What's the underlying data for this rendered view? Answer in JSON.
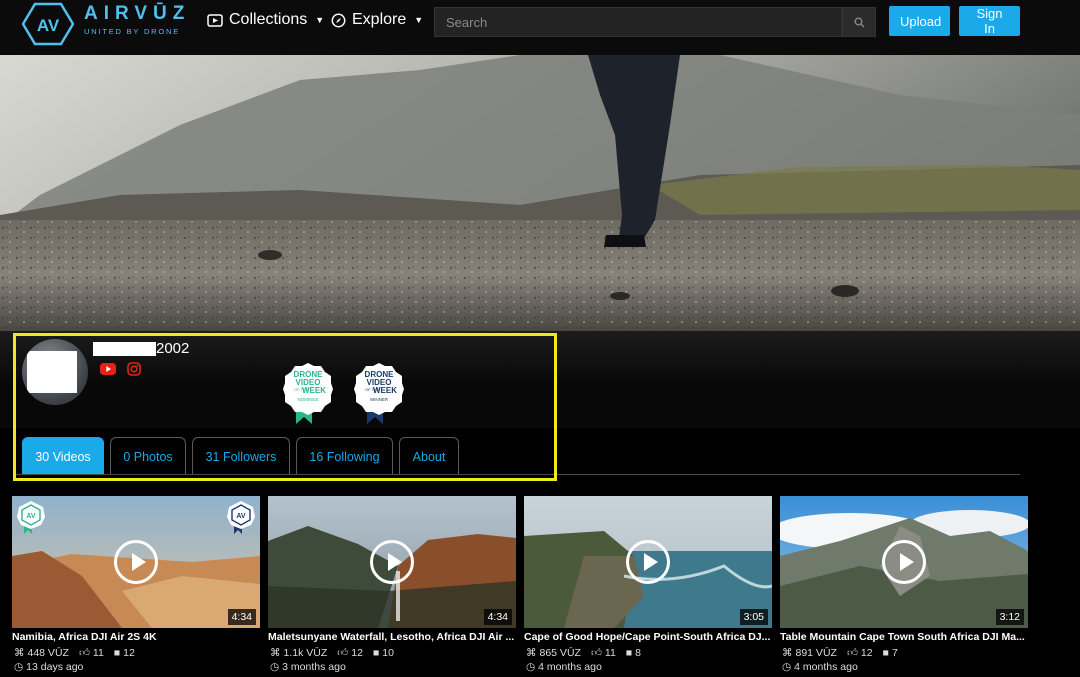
{
  "brand": {
    "name": "AIRVŪZ",
    "tagline": "UNITED BY DRONE",
    "logo_text": "AV"
  },
  "nav": {
    "collections": "Collections",
    "explore": "Explore",
    "search_placeholder": "Search",
    "upload": "Upload",
    "sign_in": "Sign In"
  },
  "profile": {
    "username_suffix": "2002",
    "social": [
      "youtube-icon",
      "instagram-icon"
    ],
    "badges": [
      {
        "line1": "DRONE",
        "line2": "VIDEO",
        "line3": "OF THE",
        "line4": "WEEK",
        "line5": "NOMINEE",
        "color": "#2bb58a"
      },
      {
        "line1": "DRONE",
        "line2": "VIDEO",
        "line3": "OF THE",
        "line4": "WEEK",
        "line5": "WINNER",
        "color": "#1b3a6b"
      }
    ]
  },
  "tabs": [
    {
      "label": "30 Videos",
      "active": true
    },
    {
      "label": "0 Photos"
    },
    {
      "label": "31 Followers"
    },
    {
      "label": "16 Following"
    },
    {
      "label": "About"
    }
  ],
  "videos": [
    {
      "title": "Namibia, Africa DJI Air 2S 4K",
      "views": "448 VŪZ",
      "likes": "11",
      "comments": "12",
      "age": "13 days ago",
      "duration": "4:34"
    },
    {
      "title": "Maletsunyane Waterfall, Lesotho, Africa DJI Air ...",
      "views": "1.1k VŪZ",
      "likes": "12",
      "comments": "10",
      "age": "3 months ago",
      "duration": "4:34"
    },
    {
      "title": "Cape of Good Hope/Cape Point-South Africa DJ...",
      "views": "865 VŪZ",
      "likes": "11",
      "comments": "8",
      "age": "4 months ago",
      "duration": "3:05"
    },
    {
      "title": "Table Mountain Cape Town South Africa DJI Ma...",
      "views": "891 VŪZ",
      "likes": "12",
      "comments": "7",
      "age": "4 months ago",
      "duration": "3:12"
    }
  ],
  "colors": {
    "accent": "#1aa9e9",
    "brand": "#4fc1ec",
    "highlight": "#ecec1a"
  }
}
